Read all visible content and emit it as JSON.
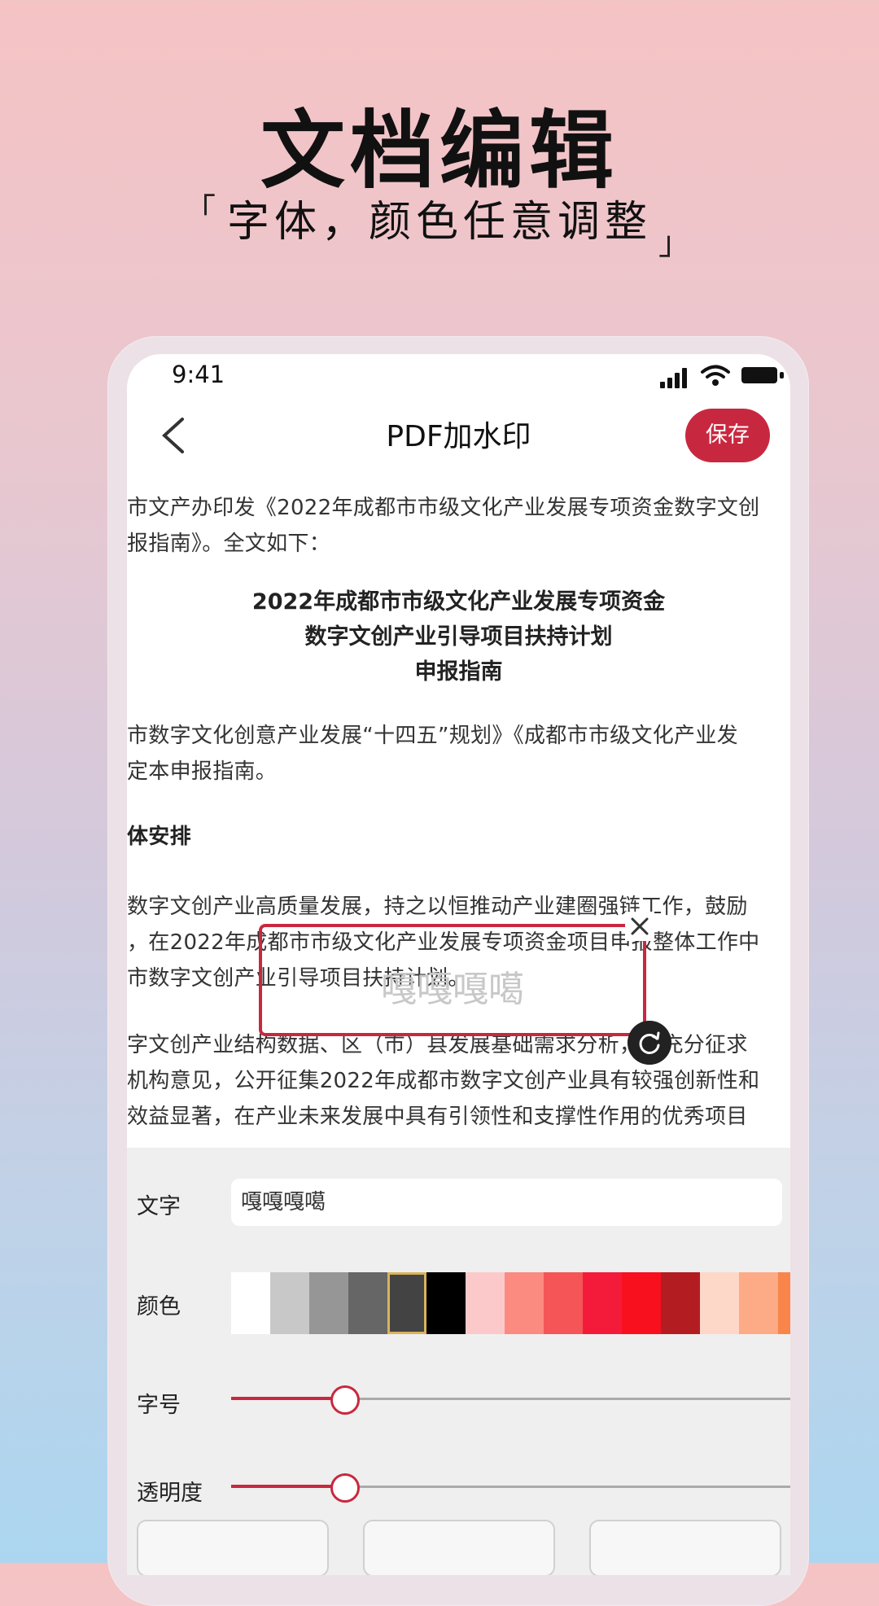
{
  "promo": {
    "title": "文档编辑",
    "subtitle": "字体，颜色任意调整",
    "bracket_left": "「",
    "bracket_right": "」"
  },
  "status_bar": {
    "time": "9:41",
    "icons": [
      "signal-icon",
      "wifi-icon",
      "battery-icon"
    ]
  },
  "nav": {
    "back_icon": "chevron-left-icon",
    "title": "PDF加水印",
    "save_label": "保存",
    "accent": "#c8283f"
  },
  "document": {
    "lines": [
      "市文产办印发《2022年成都市市级文化产业发展专项资金数字文创",
      "报指南》。全文如下："
    ],
    "center_title": [
      "2022年成都市市级文化产业发展专项资金",
      "数字文创产业引导项目扶持计划",
      "申报指南"
    ],
    "para1": [
      "市数字文化创意产业发展“十四五”规划》《成都市市级文化产业发",
      "定本申报指南。"
    ],
    "section_heading": "体安排",
    "para2": [
      "数字文创产业高质量发展，持之以恒推动产业建圈强链工作，鼓励",
      "，在2022年成都市市级文化产业发展专项资金项目申报整体工作中",
      "市数字文创产业引导项目扶持计划。"
    ],
    "para3": [
      "字文创产业结构数据、区（市）县发展基础需求分析，经充分征求",
      "机构意见，公开征集2022年成都市数字文创产业具有较强创新性和",
      "效益显著，在产业未来发展中具有引领性和支撑性作用的优秀项目"
    ]
  },
  "watermark": {
    "text": "嘎嘎嘎噶",
    "close_icon": "close-icon",
    "rotate_icon": "rotate-icon"
  },
  "panel": {
    "text_label": "文字",
    "text_value": "嘎嘎嘎噶",
    "color_label": "颜色",
    "colors": [
      "#ffffff",
      "#c8c8c8",
      "#969696",
      "#666666",
      "#434343",
      "#000000",
      "#fcc9cb",
      "#fb8a80",
      "#f55557",
      "#f41b3a",
      "#f8101e",
      "#b31c20",
      "#fdd8c8",
      "#fcab86",
      "#f9854a"
    ],
    "selected_color_index": 4,
    "size_label": "字号",
    "size_value": 0.2,
    "opacity_label": "透明度",
    "opacity_value": 0.2,
    "buttons": [
      "",
      "",
      ""
    ]
  }
}
